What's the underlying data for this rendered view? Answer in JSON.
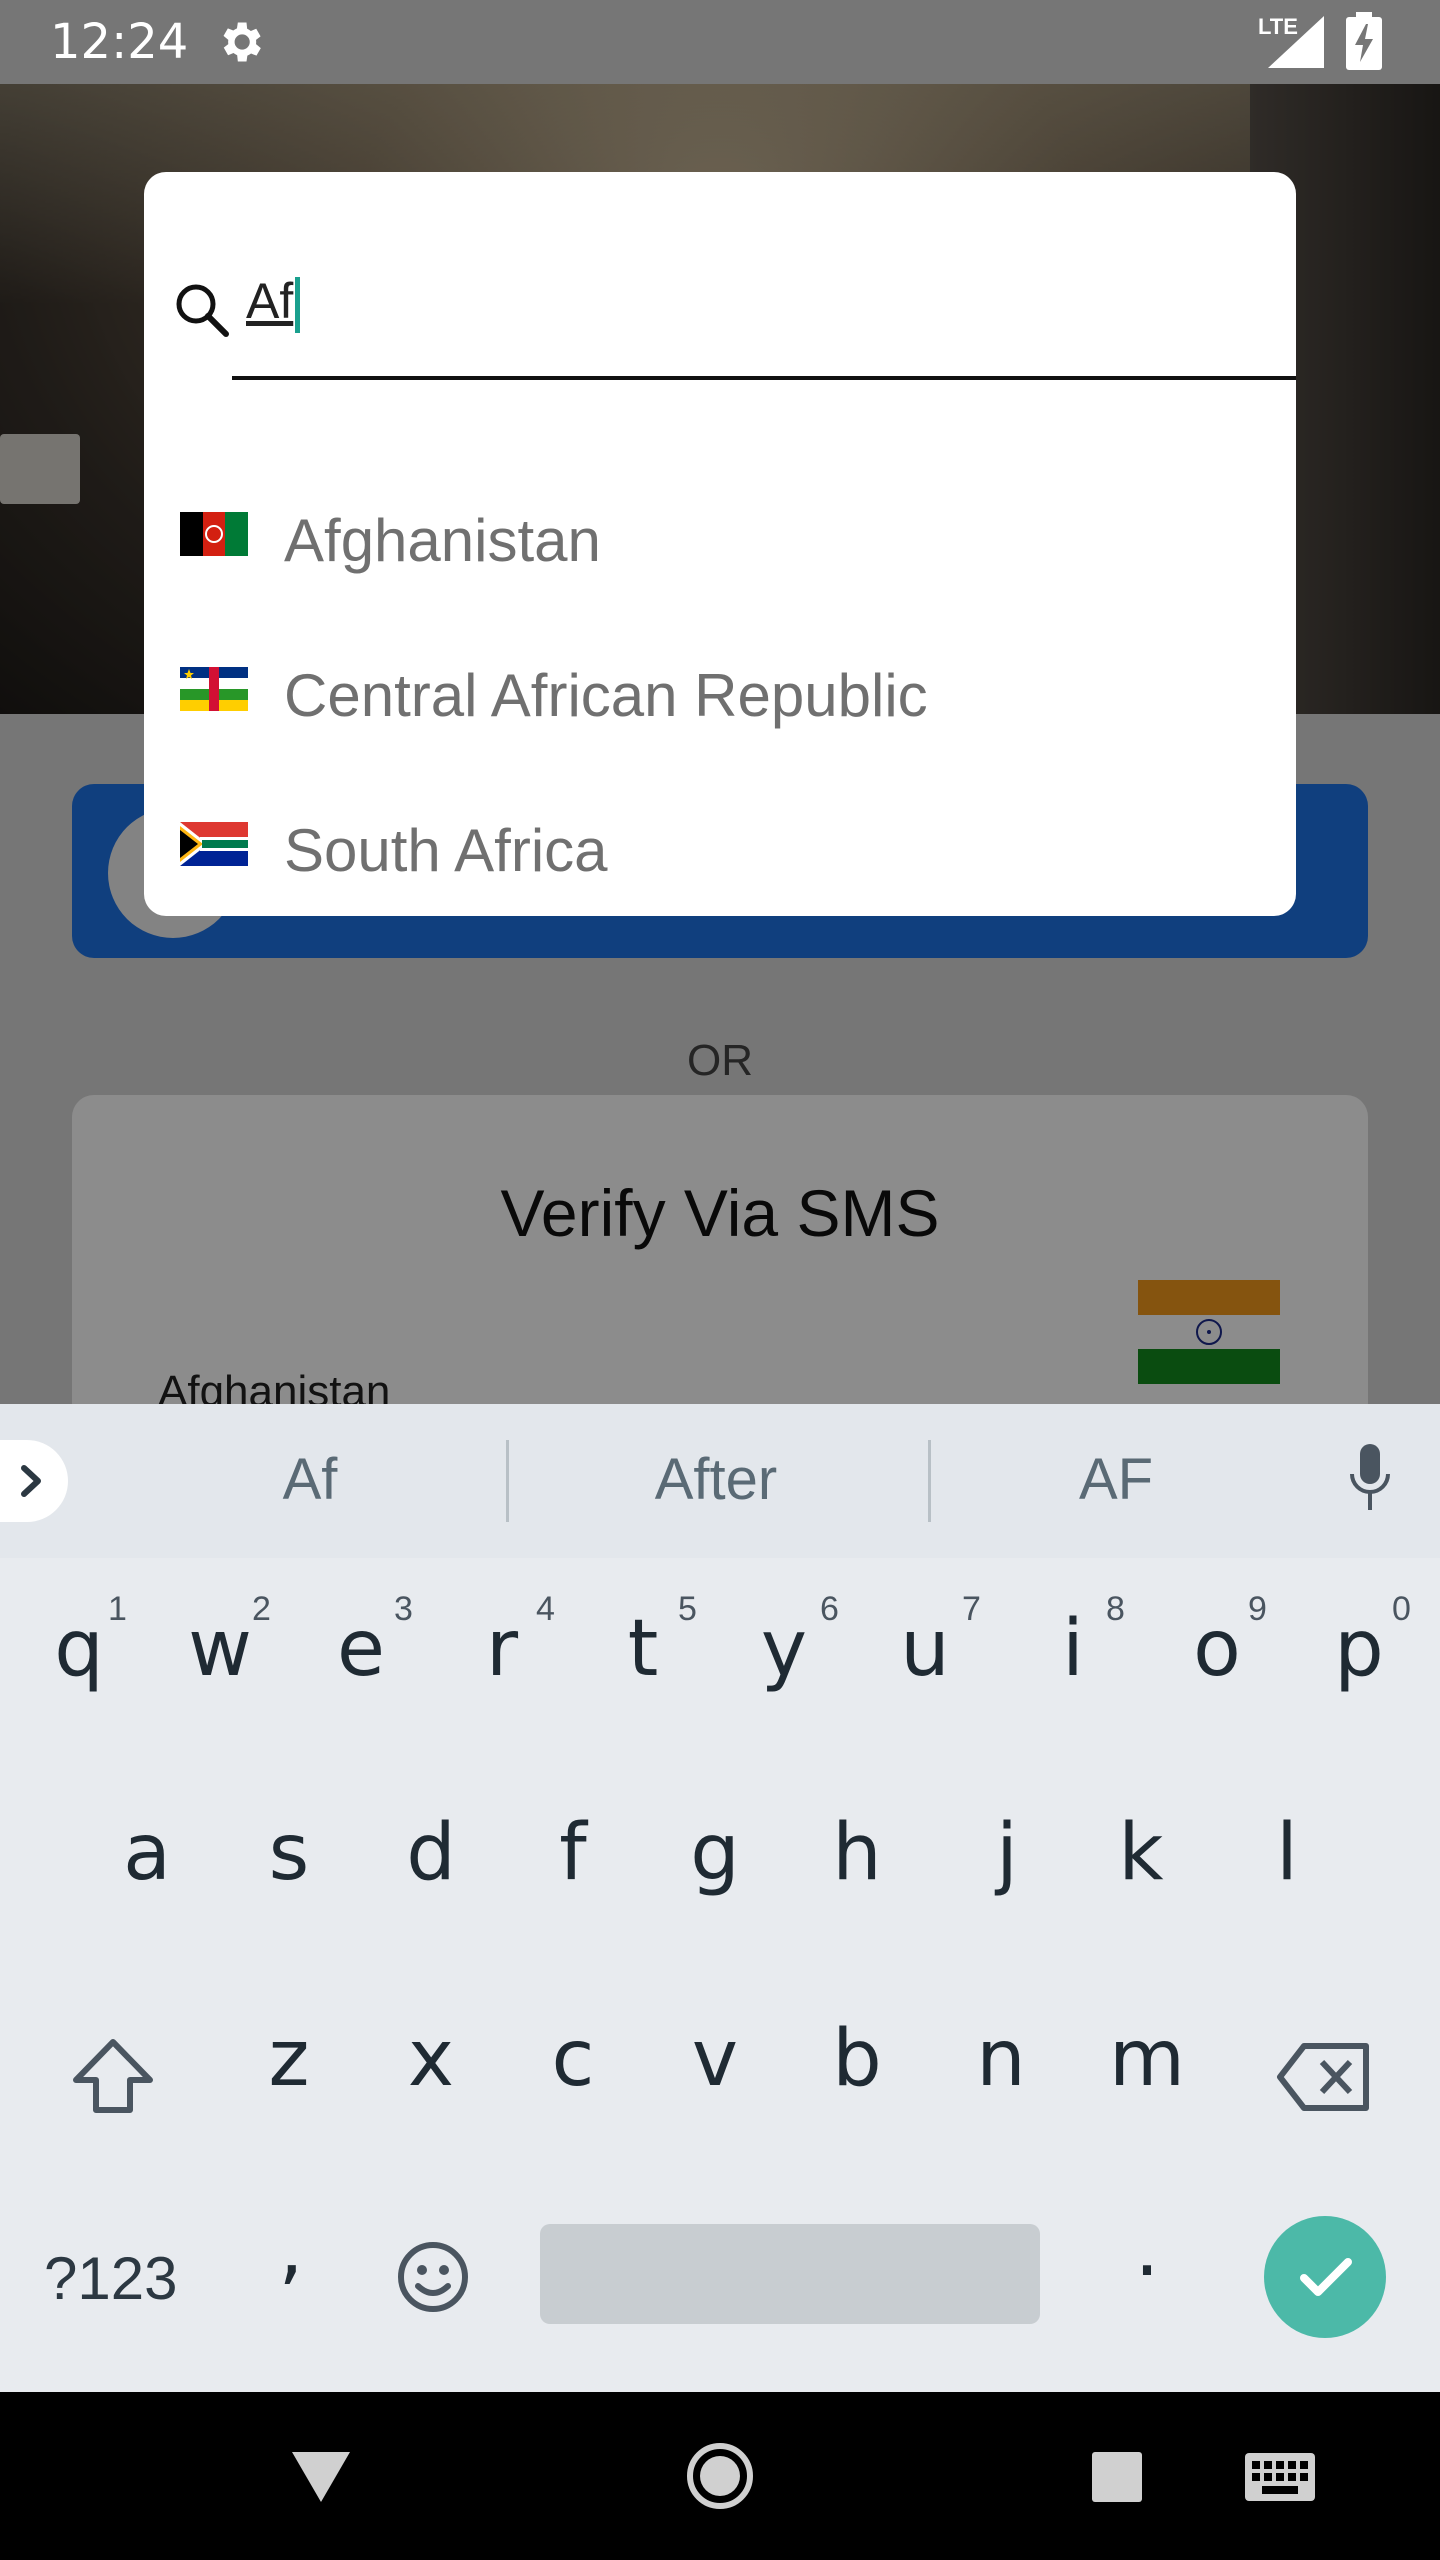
{
  "status_bar": {
    "time": "12:24",
    "network": "LTE"
  },
  "popup": {
    "search": {
      "value": "Af"
    },
    "countries": [
      {
        "name": "Afghanistan"
      },
      {
        "name": "Central African Republic"
      },
      {
        "name": "South Africa"
      }
    ]
  },
  "background": {
    "or_label": "OR",
    "sms_title": "Verify Via SMS",
    "sms_country": "Afghanistan"
  },
  "keyboard": {
    "suggestions": [
      "Af",
      "After",
      "AF"
    ],
    "row1": [
      "q",
      "w",
      "e",
      "r",
      "t",
      "y",
      "u",
      "i",
      "o",
      "p"
    ],
    "row1_numbers": [
      "1",
      "2",
      "3",
      "4",
      "5",
      "6",
      "7",
      "8",
      "9",
      "0"
    ],
    "row2": [
      "a",
      "s",
      "d",
      "f",
      "g",
      "h",
      "j",
      "k",
      "l"
    ],
    "row3": [
      "z",
      "x",
      "c",
      "v",
      "b",
      "n",
      "m"
    ],
    "symbols_label": "?123",
    "comma": ",",
    "period": "."
  },
  "colors": {
    "accent": "#4cb9a8",
    "primary_button": "#1e73e6"
  }
}
